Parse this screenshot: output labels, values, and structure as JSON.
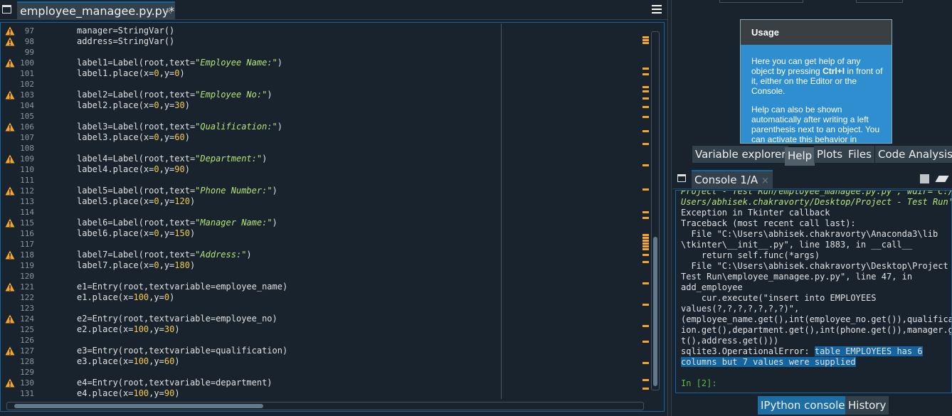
{
  "editor": {
    "tab_label": "employee_managee.py.py*",
    "tab_close": "×",
    "lines": [
      {
        "n": "97",
        "warn": true,
        "code": [
          {
            "t": "manager=StringVar()"
          }
        ]
      },
      {
        "n": "98",
        "warn": true,
        "code": [
          {
            "t": "address=StringVar()"
          }
        ]
      },
      {
        "n": "99",
        "warn": false,
        "code": []
      },
      {
        "n": "100",
        "warn": true,
        "code": [
          {
            "t": "label1=Label(root,text="
          },
          {
            "t": "\"Employee Name:\"",
            "c": "str"
          },
          {
            "t": ")"
          }
        ]
      },
      {
        "n": "101",
        "warn": false,
        "code": [
          {
            "t": "label1.place(x="
          },
          {
            "t": "0",
            "c": "num"
          },
          {
            "t": ",y="
          },
          {
            "t": "0",
            "c": "num"
          },
          {
            "t": ")"
          }
        ]
      },
      {
        "n": "102",
        "warn": false,
        "code": []
      },
      {
        "n": "103",
        "warn": true,
        "code": [
          {
            "t": "label2=Label(root,text="
          },
          {
            "t": "\"Employee No:\"",
            "c": "str"
          },
          {
            "t": ")"
          }
        ]
      },
      {
        "n": "104",
        "warn": false,
        "code": [
          {
            "t": "label2.place(x="
          },
          {
            "t": "0",
            "c": "num"
          },
          {
            "t": ",y="
          },
          {
            "t": "30",
            "c": "num"
          },
          {
            "t": ")"
          }
        ]
      },
      {
        "n": "105",
        "warn": false,
        "code": []
      },
      {
        "n": "106",
        "warn": true,
        "code": [
          {
            "t": "label3=Label(root,text="
          },
          {
            "t": "\"Qualification:\"",
            "c": "str"
          },
          {
            "t": ")"
          }
        ]
      },
      {
        "n": "107",
        "warn": false,
        "code": [
          {
            "t": "label3.place(x="
          },
          {
            "t": "0",
            "c": "num"
          },
          {
            "t": ",y="
          },
          {
            "t": "60",
            "c": "num"
          },
          {
            "t": ")"
          }
        ]
      },
      {
        "n": "108",
        "warn": false,
        "code": []
      },
      {
        "n": "109",
        "warn": true,
        "code": [
          {
            "t": "label4=Label(root,text="
          },
          {
            "t": "\"Department:\"",
            "c": "str"
          },
          {
            "t": ")"
          }
        ]
      },
      {
        "n": "110",
        "warn": false,
        "code": [
          {
            "t": "label4.place(x="
          },
          {
            "t": "0",
            "c": "num"
          },
          {
            "t": ",y="
          },
          {
            "t": "90",
            "c": "num"
          },
          {
            "t": ")"
          }
        ]
      },
      {
        "n": "111",
        "warn": false,
        "code": []
      },
      {
        "n": "112",
        "warn": true,
        "code": [
          {
            "t": "label5=Label(root,text="
          },
          {
            "t": "\"Phone Number:\"",
            "c": "str"
          },
          {
            "t": ")"
          }
        ]
      },
      {
        "n": "113",
        "warn": false,
        "code": [
          {
            "t": "label5.place(x="
          },
          {
            "t": "0",
            "c": "num"
          },
          {
            "t": ",y="
          },
          {
            "t": "120",
            "c": "num"
          },
          {
            "t": ")"
          }
        ]
      },
      {
        "n": "114",
        "warn": false,
        "code": []
      },
      {
        "n": "115",
        "warn": true,
        "code": [
          {
            "t": "label6=Label(root,text="
          },
          {
            "t": "\"Manager Name:\"",
            "c": "str"
          },
          {
            "t": ")"
          }
        ]
      },
      {
        "n": "116",
        "warn": false,
        "code": [
          {
            "t": "label6.place(x="
          },
          {
            "t": "0",
            "c": "num"
          },
          {
            "t": ",y="
          },
          {
            "t": "150",
            "c": "num"
          },
          {
            "t": ")"
          }
        ]
      },
      {
        "n": "117",
        "warn": false,
        "code": []
      },
      {
        "n": "118",
        "warn": true,
        "code": [
          {
            "t": "label7=Label(root,text="
          },
          {
            "t": "\"Address:\"",
            "c": "str"
          },
          {
            "t": ")"
          }
        ]
      },
      {
        "n": "119",
        "warn": false,
        "code": [
          {
            "t": "label7.place(x="
          },
          {
            "t": "0",
            "c": "num"
          },
          {
            "t": ",y="
          },
          {
            "t": "180",
            "c": "num"
          },
          {
            "t": ")"
          }
        ]
      },
      {
        "n": "120",
        "warn": false,
        "code": []
      },
      {
        "n": "121",
        "warn": true,
        "code": [
          {
            "t": "e1=Entry(root,textvariable=employee_name)"
          }
        ]
      },
      {
        "n": "122",
        "warn": false,
        "code": [
          {
            "t": "e1.place(x="
          },
          {
            "t": "100",
            "c": "num"
          },
          {
            "t": ",y="
          },
          {
            "t": "0",
            "c": "num"
          },
          {
            "t": ")"
          }
        ]
      },
      {
        "n": "123",
        "warn": false,
        "code": []
      },
      {
        "n": "124",
        "warn": true,
        "code": [
          {
            "t": "e2=Entry(root,textvariable=employee_no)"
          }
        ]
      },
      {
        "n": "125",
        "warn": false,
        "code": [
          {
            "t": "e2.place(x="
          },
          {
            "t": "100",
            "c": "num"
          },
          {
            "t": ",y="
          },
          {
            "t": "30",
            "c": "num"
          },
          {
            "t": ")"
          }
        ]
      },
      {
        "n": "126",
        "warn": false,
        "code": []
      },
      {
        "n": "127",
        "warn": true,
        "code": [
          {
            "t": "e3=Entry(root,textvariable=qualification)"
          }
        ]
      },
      {
        "n": "128",
        "warn": false,
        "code": [
          {
            "t": "e3.place(x="
          },
          {
            "t": "100",
            "c": "num"
          },
          {
            "t": ",y="
          },
          {
            "t": "60",
            "c": "num"
          },
          {
            "t": ")"
          }
        ]
      },
      {
        "n": "129",
        "warn": false,
        "code": []
      },
      {
        "n": "130",
        "warn": true,
        "code": [
          {
            "t": "e4=Entry(root,textvariable=department)"
          }
        ]
      },
      {
        "n": "131",
        "warn": false,
        "code": [
          {
            "t": "e4.place(x="
          },
          {
            "t": "100",
            "c": "num"
          },
          {
            "t": ",y="
          },
          {
            "t": "90",
            "c": "num"
          },
          {
            "t": ")"
          }
        ]
      }
    ]
  },
  "help": {
    "usage_title": "Usage",
    "usage_p1_a": "Here you can get help of any object by pressing ",
    "usage_p1_key": "Ctrl+I",
    "usage_p1_b": " in front of it, either on the Editor or the Console.",
    "usage_p2": "Help can also be shown automatically after writing a left parenthesis next to an object. You can activate this behavior in",
    "tabs": [
      "Variable explorer",
      "Help",
      "Plots",
      "Files",
      "Code Analysis"
    ],
    "active_tab": "Help"
  },
  "console": {
    "tab_label": "Console 1/A",
    "tab_close": "×",
    "lines": [
      {
        "parts": [
          {
            "t": "Project - Test Run/employee_managee.py.py', wdir='C:/",
            "c": "it"
          }
        ]
      },
      {
        "parts": [
          {
            "t": "Users/abhisek.chakravorty/Desktop/Project - Test Run')",
            "c": "it"
          }
        ]
      },
      {
        "parts": [
          {
            "t": "Exception in Tkinter callback"
          }
        ]
      },
      {
        "parts": [
          {
            "t": "Traceback (most recent call last):"
          }
        ]
      },
      {
        "parts": [
          {
            "t": "  File \"C:\\Users\\abhisek.chakravorty\\Anaconda3\\lib"
          }
        ]
      },
      {
        "parts": [
          {
            "t": "\\tkinter\\__init__.py\", line 1883, in __call__"
          }
        ]
      },
      {
        "parts": [
          {
            "t": "    return self.func(*args)"
          }
        ]
      },
      {
        "parts": [
          {
            "t": "  File \"C:\\Users\\abhisek.chakravorty\\Desktop\\Project -"
          }
        ]
      },
      {
        "parts": [
          {
            "t": "Test Run\\employee_managee.py.py\", line 47, in"
          }
        ]
      },
      {
        "parts": [
          {
            "t": "add_employee"
          }
        ]
      },
      {
        "parts": [
          {
            "t": "    cur.execute(\"insert into EMPLOYEES"
          }
        ]
      },
      {
        "parts": [
          {
            "t": "values(?,?,?,?,?,?,?)\","
          }
        ]
      },
      {
        "parts": [
          {
            "t": "(employee_name.get(),int(employee_no.get()),qualificat"
          }
        ]
      },
      {
        "parts": [
          {
            "t": "ion.get(),department.get(),int(phone.get()),manager.ge"
          }
        ]
      },
      {
        "parts": [
          {
            "t": "t(),address.get()))"
          }
        ]
      },
      {
        "parts": [
          {
            "t": "sqlite3.OperationalError: "
          },
          {
            "t": "table EMPLOYEES has 6",
            "c": "sel"
          }
        ]
      },
      {
        "parts": [
          {
            "t": "columns but 7 values were supplied",
            "c": "sel"
          }
        ]
      },
      {
        "parts": []
      },
      {
        "parts": [
          {
            "t": "In [2]:",
            "c": "prompt"
          }
        ]
      }
    ],
    "tabs": [
      "IPython console",
      "History"
    ],
    "active_tab": "IPython console"
  },
  "colors": {
    "background": "#19232d",
    "accent": "#1464a0",
    "warning": "#f5a623",
    "string": "#b5e37a",
    "number": "#f2c94c",
    "usage_body": "#2f8ed0"
  },
  "icons": [
    "tab-switcher-icon",
    "options-menu-icon",
    "warning-icon",
    "stop-icon",
    "eraser-icon"
  ]
}
